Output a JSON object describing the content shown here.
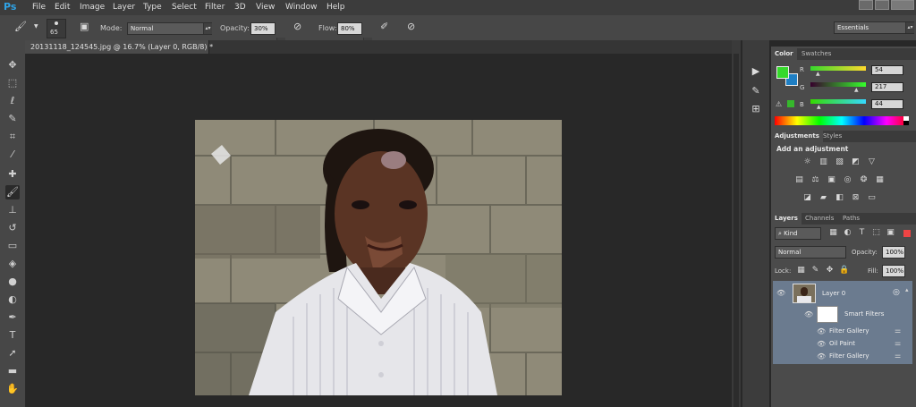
{
  "app": {
    "logo": "Ps"
  },
  "menu": [
    "File",
    "Edit",
    "Image",
    "Layer",
    "Type",
    "Select",
    "Filter",
    "3D",
    "View",
    "Window",
    "Help"
  ],
  "options": {
    "brush_size": "65",
    "mode_label": "Mode:",
    "mode_value": "Normal",
    "opacity_label": "Opacity:",
    "opacity_value": "30%",
    "flow_label": "Flow:",
    "flow_value": "80%",
    "workspace": "Essentials"
  },
  "document": {
    "tab_title": "20131118_124545.jpg @ 16.7% (Layer 0, RGB/8) *"
  },
  "color_panel": {
    "tabs": [
      "Color",
      "Swatches"
    ],
    "channels": [
      {
        "label": "R",
        "value": "54"
      },
      {
        "label": "G",
        "value": "217"
      },
      {
        "label": "B",
        "value": "44"
      }
    ],
    "foreground_color": "#36d92c",
    "background_color": "#1f7fc4"
  },
  "adjustments_panel": {
    "tabs": [
      "Adjustments",
      "Styles"
    ],
    "heading": "Add an adjustment"
  },
  "layers_panel": {
    "tabs": [
      "Layers",
      "Channels",
      "Paths"
    ],
    "kind": "Kind",
    "blend_mode": "Normal",
    "opacity_label": "Opacity:",
    "opacity_value": "100%",
    "lock_label": "Lock:",
    "fill_label": "Fill:",
    "fill_value": "100%",
    "layer_name": "Layer 0",
    "smart_filters_label": "Smart Filters",
    "filters": [
      "Filter Gallery",
      "Oil Paint",
      "Filter Gallery"
    ]
  },
  "accent_colors": {
    "selection": "#6b7b8f",
    "ps_blue": "#2fa3e6"
  }
}
